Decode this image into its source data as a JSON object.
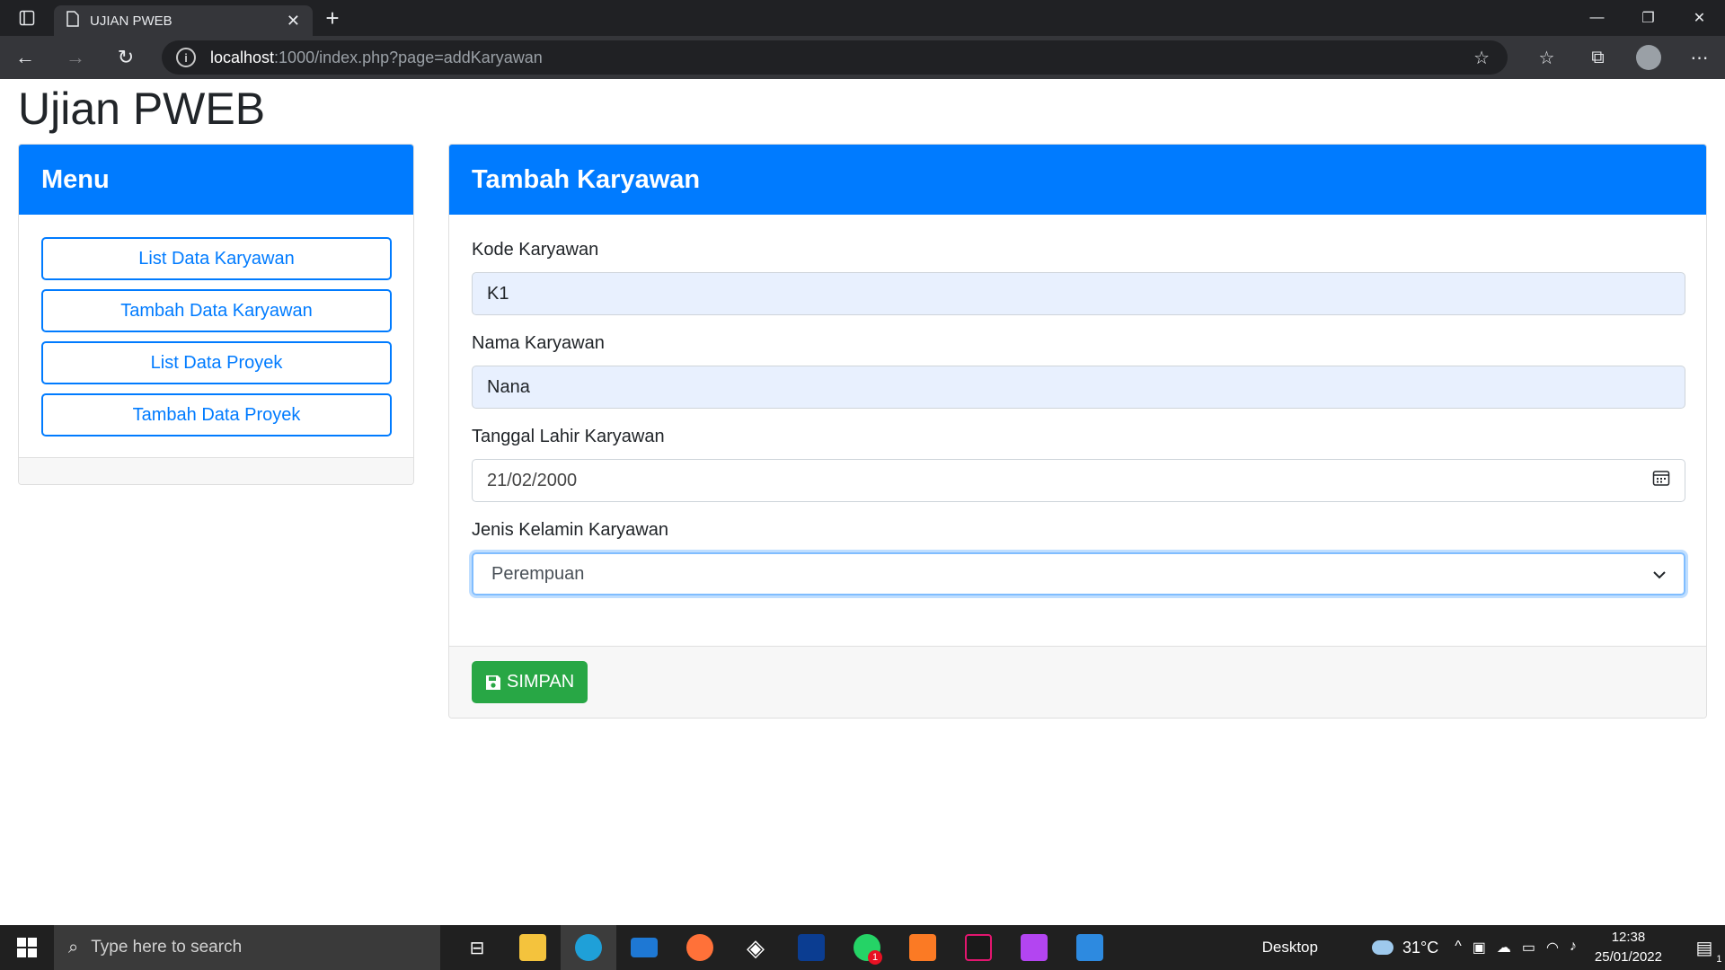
{
  "browser": {
    "tab_title": "UJIAN PWEB",
    "url_host": "localhost",
    "url_rest": ":1000/index.php?page=addKaryawan"
  },
  "page": {
    "site_title": "Ujian PWEB",
    "menu": {
      "header": "Menu",
      "items": [
        {
          "label": "List Data Karyawan"
        },
        {
          "label": "Tambah Data Karyawan"
        },
        {
          "label": "List Data Proyek"
        },
        {
          "label": "Tambah Data Proyek"
        }
      ]
    },
    "form": {
      "header": "Tambah Karyawan",
      "kode": {
        "label": "Kode Karyawan",
        "value": "K1"
      },
      "nama": {
        "label": "Nama Karyawan",
        "value": "Nana"
      },
      "tanggal": {
        "label": "Tanggal Lahir Karyawan",
        "value": "21/02/2000"
      },
      "jenis_kelamin": {
        "label": "Jenis Kelamin Karyawan",
        "value": "Perempuan"
      },
      "save_label": "SIMPAN"
    }
  },
  "taskbar": {
    "search_placeholder": "Type here to search",
    "desktop_label": "Desktop",
    "temperature": "31°C",
    "time": "12:38",
    "date": "25/01/2022",
    "whatsapp_badge": "1",
    "notification_badge": "1"
  },
  "colors": {
    "primary": "#007bff",
    "success": "#28a745",
    "autofill": "#e8f0fe"
  }
}
